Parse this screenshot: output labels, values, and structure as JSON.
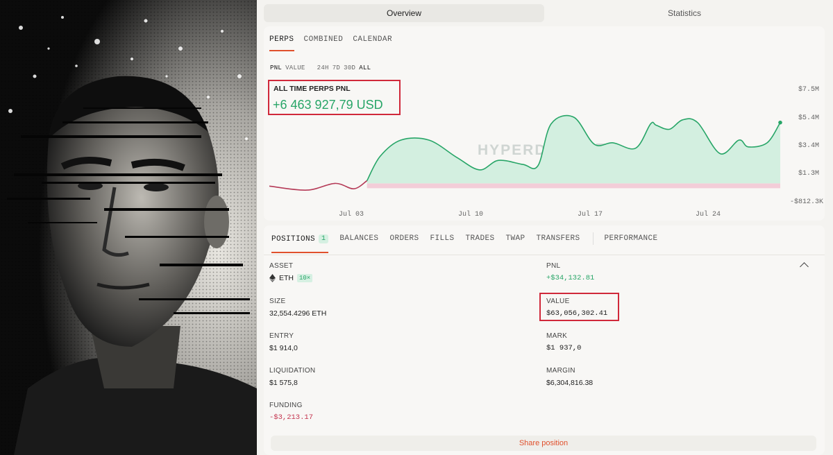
{
  "top_tabs": [
    "Overview",
    "Statistics"
  ],
  "subtabs": [
    "PERPS",
    "COMBINED",
    "CALENDAR"
  ],
  "filters": [
    "PNL",
    "VALUE",
    "24H",
    "7D",
    "30D",
    "ALL"
  ],
  "pnl": {
    "label": "ALL TIME PERPS PNL",
    "value": "+6 463 927,79 USD"
  },
  "watermark": "HYPERDASH",
  "chart_data": {
    "type": "area",
    "y_ticks": [
      "$7.5M",
      "$5.4M",
      "$3.4M",
      "$1.3M",
      "-$812.3K"
    ],
    "x_ticks": [
      "Jul 03",
      "Jul 10",
      "Jul 17",
      "Jul 24"
    ],
    "ylim": [
      -0.8123,
      7.5
    ],
    "x": [
      0,
      2,
      3.5,
      4.5,
      5.2,
      5.9,
      7,
      8.5,
      10,
      11.2,
      12.2,
      13.5,
      14.3,
      15,
      16.2,
      17.3,
      18.3,
      19.5,
      20.3,
      20.6,
      21.3,
      22,
      22.8,
      24,
      25,
      25.5,
      26.5,
      27.2
    ],
    "y": [
      0.2,
      -0.1,
      0.4,
      0.0,
      0.6,
      2.4,
      3.6,
      3.6,
      2.3,
      1.4,
      2.1,
      1.8,
      1.7,
      4.8,
      5.3,
      3.3,
      3.4,
      3.0,
      4.8,
      4.7,
      4.4,
      5.1,
      4.9,
      2.6,
      3.6,
      3.1,
      3.4,
      4.9
    ],
    "baseline": 0.4,
    "colors": {
      "positive": "#27a567",
      "positive_fill": "#d3efe0",
      "negative": "#b53a57",
      "negative_fill": "#f3cdd8"
    }
  },
  "position_tabs": [
    {
      "label": "POSITIONS",
      "badge": "1"
    },
    {
      "label": "BALANCES"
    },
    {
      "label": "ORDERS"
    },
    {
      "label": "FILLS"
    },
    {
      "label": "TRADES"
    },
    {
      "label": "TWAP"
    },
    {
      "label": "TRANSFERS"
    },
    {
      "label": "PERFORMANCE"
    }
  ],
  "position": {
    "asset_label": "ASSET",
    "asset": "ETH",
    "leverage": "10×",
    "pnl_label": "PNL",
    "pnl": "+$34,132.81",
    "size_label": "SIZE",
    "size": "32,554.4296 ETH",
    "value_label": "VALUE",
    "value": "$63,056,302.41",
    "entry_label": "ENTRY",
    "entry": "$1 914,0",
    "mark_label": "MARK",
    "mark": "$1 937,0",
    "liquidation_label": "LIQUIDATION",
    "liquidation": "$1 575,8",
    "margin_label": "MARGIN",
    "margin": "$6,304,816.38",
    "funding_label": "FUNDING",
    "funding": "-$3,213.17"
  },
  "share_label": "Share position"
}
